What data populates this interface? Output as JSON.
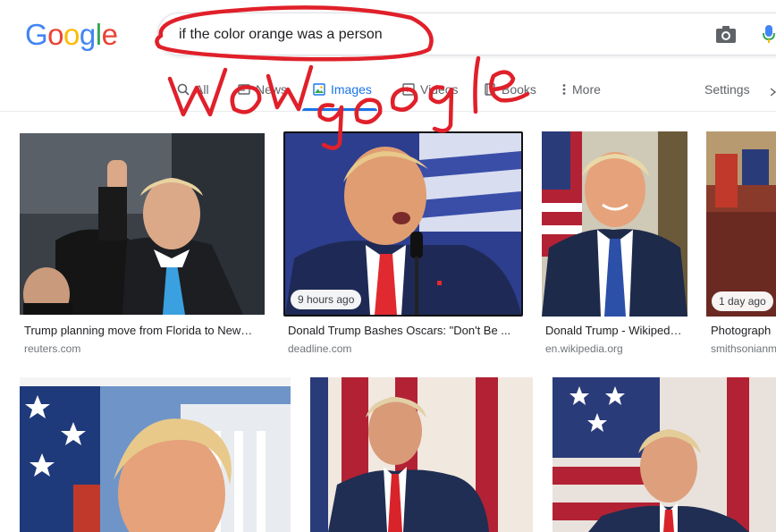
{
  "logo": {
    "letters": [
      "G",
      "o",
      "o",
      "g",
      "l",
      "e"
    ],
    "colors": [
      "#4285F4",
      "#EA4335",
      "#FBBC05",
      "#4285F4",
      "#34A853",
      "#EA4335"
    ]
  },
  "search": {
    "query": "if the color orange was a person"
  },
  "icons": {
    "camera": "camera-icon",
    "mic": "mic-icon"
  },
  "tabs": [
    {
      "label": "All",
      "icon": "search-icon"
    },
    {
      "label": "News",
      "icon": "news-icon"
    },
    {
      "label": "Images",
      "icon": "image-icon",
      "active": true
    },
    {
      "label": "Videos",
      "icon": "video-icon"
    },
    {
      "label": "Books",
      "icon": "book-icon"
    },
    {
      "label": "More",
      "icon": "more-vert-icon"
    }
  ],
  "settings_label": "Settings",
  "results": [
    {
      "caption": "Trump planning move from Florida to New…",
      "source": "reuters.com",
      "badge": ""
    },
    {
      "caption": "Donald Trump Bashes Oscars: \"Don't Be ...",
      "source": "deadline.com",
      "badge": "9 hours ago"
    },
    {
      "caption": "Donald Trump - Wikiped…",
      "source": "en.wikipedia.org",
      "badge": ""
    },
    {
      "caption": "Photograph",
      "source": "smithsonianm",
      "badge": "1 day ago"
    },
    {
      "caption": "",
      "source": "",
      "badge": ""
    },
    {
      "caption": "",
      "source": "",
      "badge": ""
    },
    {
      "caption": "",
      "source": "",
      "badge": ""
    }
  ],
  "annotation": {
    "text": "Wow google",
    "color": "#e0202a"
  }
}
